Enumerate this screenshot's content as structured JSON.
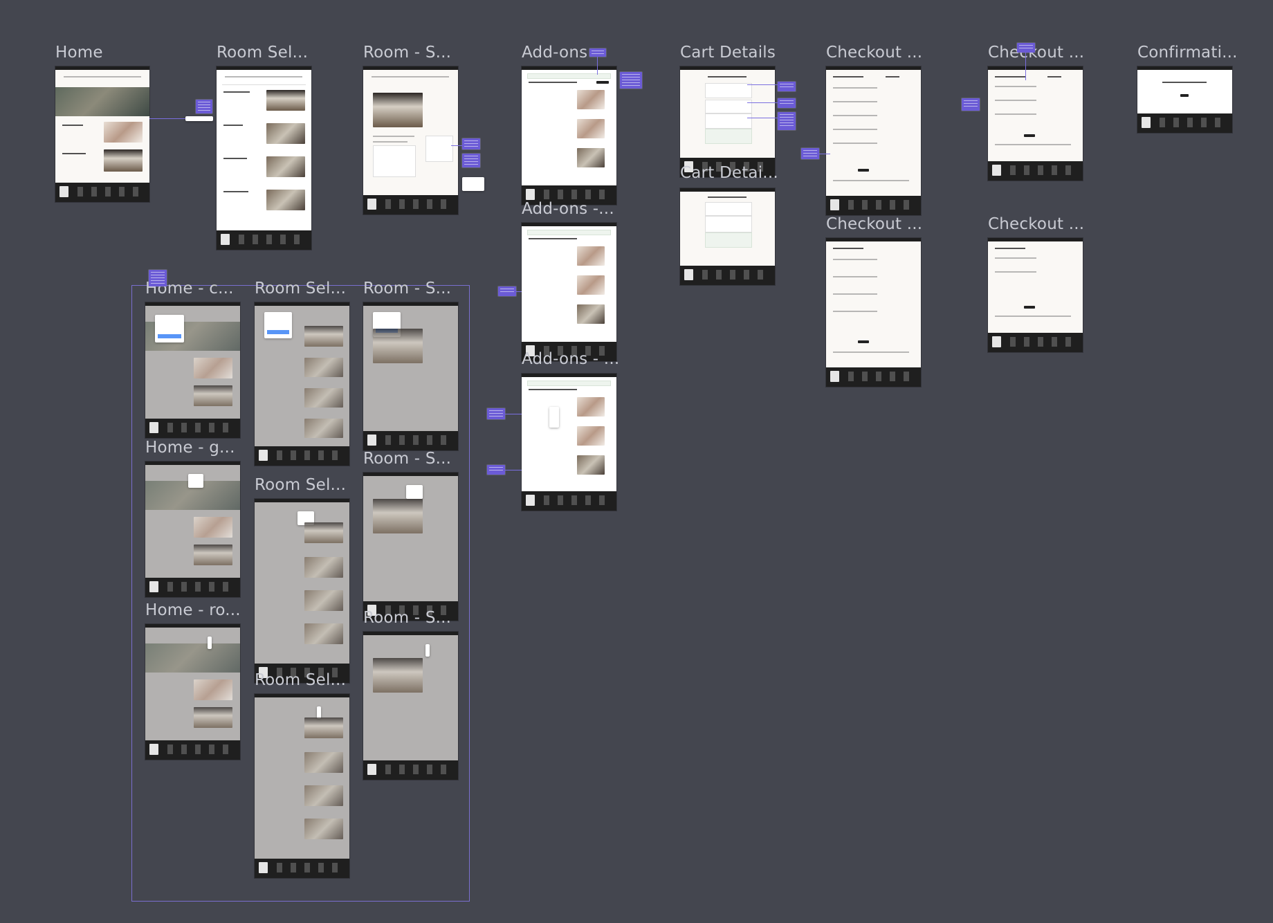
{
  "canvas": {
    "background": "#44464f",
    "annotation_color": "#6b5bd6",
    "frames": [
      {
        "id": "home",
        "label": "Home"
      },
      {
        "id": "room-sel-1",
        "label": "Room Sel..."
      },
      {
        "id": "room-s-1",
        "label": "Room - S..."
      },
      {
        "id": "addons-1",
        "label": "Add-ons"
      },
      {
        "id": "cart-1",
        "label": "Cart Details"
      },
      {
        "id": "checkout-1",
        "label": "Checkout ..."
      },
      {
        "id": "checkout-2",
        "label": "Checkout ..."
      },
      {
        "id": "confirm",
        "label": "Confirmati..."
      },
      {
        "id": "cart-2",
        "label": "Cart Detai..."
      },
      {
        "id": "addons-2",
        "label": "Add-ons -..."
      },
      {
        "id": "addons-3",
        "label": "Add-ons - ..."
      },
      {
        "id": "checkout-3",
        "label": "Checkout ..."
      },
      {
        "id": "checkout-4",
        "label": "Checkout ..."
      },
      {
        "id": "home-c",
        "label": "Home - c..."
      },
      {
        "id": "room-sel-2",
        "label": "Room Sel..."
      },
      {
        "id": "room-s-2",
        "label": "Room - S..."
      },
      {
        "id": "home-g",
        "label": "Home - g..."
      },
      {
        "id": "room-sel-3",
        "label": "Room Sel..."
      },
      {
        "id": "room-s-3",
        "label": "Room - S..."
      },
      {
        "id": "home-ro",
        "label": "Home - ro..."
      },
      {
        "id": "room-sel-4",
        "label": "Room Sel..."
      },
      {
        "id": "room-s-4",
        "label": "Room - S..."
      }
    ]
  }
}
